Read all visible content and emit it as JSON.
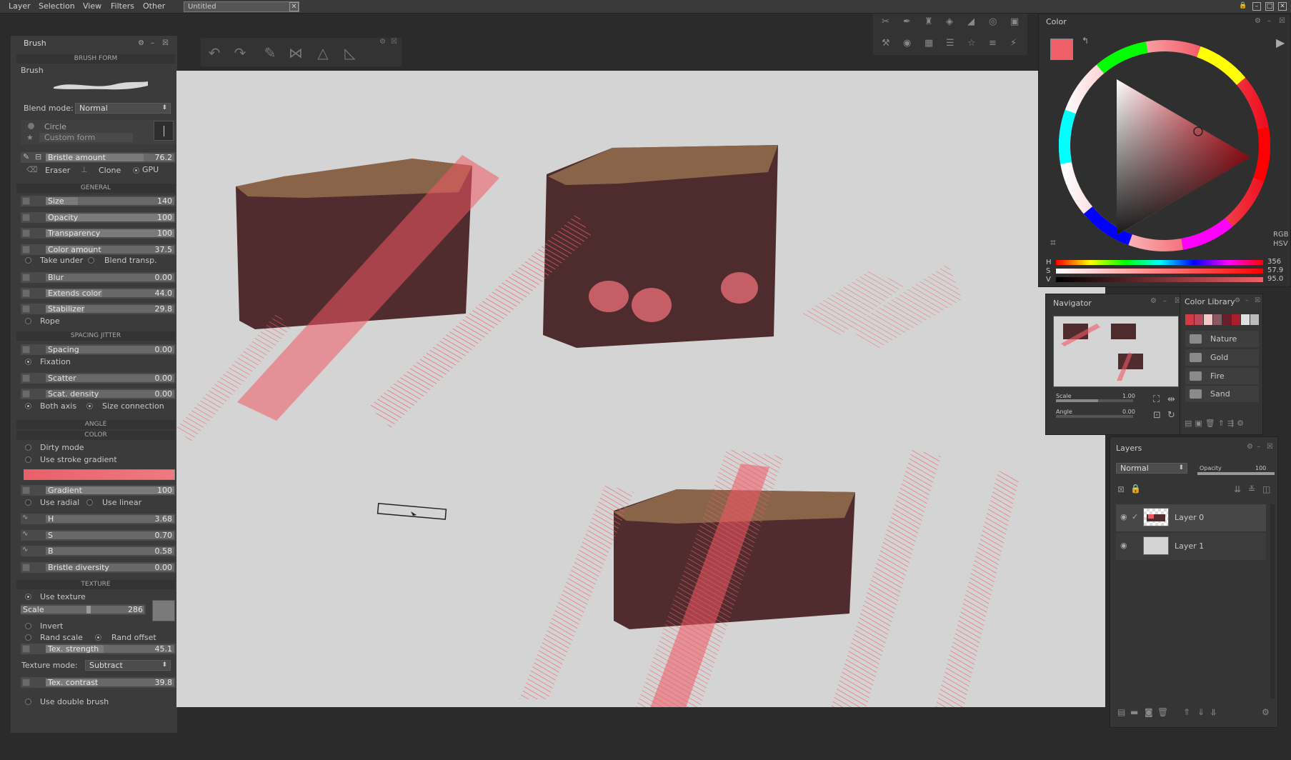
{
  "menu": [
    "Layer",
    "Selection",
    "View",
    "Filters",
    "Other"
  ],
  "document_tab": "Untitled",
  "brush_panel": {
    "title": "Brush",
    "section_brush_form": "BRUSH FORM",
    "brush_label": "Brush",
    "blend_mode_label": "Blend mode:",
    "blend_mode_value": "Normal",
    "form_circle": "Circle",
    "form_custom": "Custom form",
    "bristle_amount": {
      "name": "Bristle amount",
      "value": "76.2",
      "fill": 0.76
    },
    "eraser": "Eraser",
    "clone": "Clone",
    "gpu": "GPU",
    "section_general": "GENERAL",
    "size": {
      "name": "Size",
      "value": "140",
      "fill": 0.25
    },
    "opacity": {
      "name": "Opacity",
      "value": "100",
      "fill": 1.0
    },
    "transparency": {
      "name": "Transparency",
      "value": "100",
      "fill": 1.0
    },
    "color_amount": {
      "name": "Color amount",
      "value": "37.5",
      "fill": 0.375
    },
    "take_under": "Take under",
    "blend_transp": "Blend transp.",
    "blur": {
      "name": "Blur",
      "value": "0.00",
      "fill": 0
    },
    "extends_color": {
      "name": "Extends color",
      "value": "44.0",
      "fill": 0.44
    },
    "stabilizer": {
      "name": "Stabilizer",
      "value": "29.8",
      "fill": 0.3
    },
    "rope": "Rope",
    "section_spacing": "SPACING JITTER",
    "spacing": {
      "name": "Spacing",
      "value": "0.00",
      "fill": 0
    },
    "fixation": "Fixation",
    "scatter": {
      "name": "Scatter",
      "value": "0.00",
      "fill": 0
    },
    "scat_density": {
      "name": "Scat. density",
      "value": "0.00",
      "fill": 0
    },
    "both_axis": "Both axis",
    "size_connection": "Size connection",
    "section_angle": "ANGLE",
    "section_color": "COLOR",
    "dirty_mode": "Dirty mode",
    "use_stroke_gradient": "Use stroke gradient",
    "gradient": {
      "name": "Gradient",
      "value": "100",
      "fill": 1.0
    },
    "use_radial": "Use radial",
    "use_linear": "Use linear",
    "h": {
      "name": "H",
      "value": "3.68",
      "fill": 0
    },
    "s": {
      "name": "S",
      "value": "0.70",
      "fill": 0
    },
    "b": {
      "name": "B",
      "value": "0.58",
      "fill": 0
    },
    "bristle_diversity": {
      "name": "Bristle diversity",
      "value": "0.00",
      "fill": 0
    },
    "section_texture": "TEXTURE",
    "use_texture": "Use texture",
    "scale": {
      "name": "Scale",
      "value": "286",
      "fill": 0.48
    },
    "invert": "Invert",
    "rand_scale": "Rand scale",
    "rand_offset": "Rand offset",
    "tex_strength": {
      "name": "Tex. strength",
      "value": "45.1",
      "fill": 0.45
    },
    "texture_mode_label": "Texture mode:",
    "texture_mode_value": "Subtract",
    "tex_contrast": {
      "name": "Tex. contrast",
      "value": "39.8",
      "fill": 0.4
    },
    "use_double_brush": "Use double brush"
  },
  "color_panel": {
    "title": "Color",
    "rgb": "RGB",
    "hsv": "HSV",
    "h_label": "H",
    "h_value": "356",
    "s_label": "S",
    "s_value": "57.9",
    "v_label": "V",
    "v_value": "95.0",
    "current_color": "#f06068"
  },
  "navigator": {
    "title": "Navigator",
    "scale_label": "Scale",
    "scale_value": "1.00",
    "angle_label": "Angle",
    "angle_value": "0.00"
  },
  "color_library": {
    "title": "Color Library",
    "swatches": [
      "#d23a44",
      "#b84c5a",
      "#f2c8cc",
      "#8a5a60",
      "#6a1e2a",
      "#a8202c",
      "#e0e0e0",
      "#bcbcbc"
    ],
    "folders": [
      "Nature",
      "Gold",
      "Fire",
      "Sand"
    ]
  },
  "layers": {
    "title": "Layers",
    "blend_mode": "Normal",
    "opacity_label": "Opacity",
    "opacity_value": "100",
    "items": [
      {
        "name": "Layer 0"
      },
      {
        "name": "Layer 1"
      }
    ]
  },
  "colors": {
    "accent": "#f06068",
    "cake_dark": "#4e2c2e",
    "cake_top": "#8a6448",
    "canvas_bg": "#d4d4d4"
  }
}
